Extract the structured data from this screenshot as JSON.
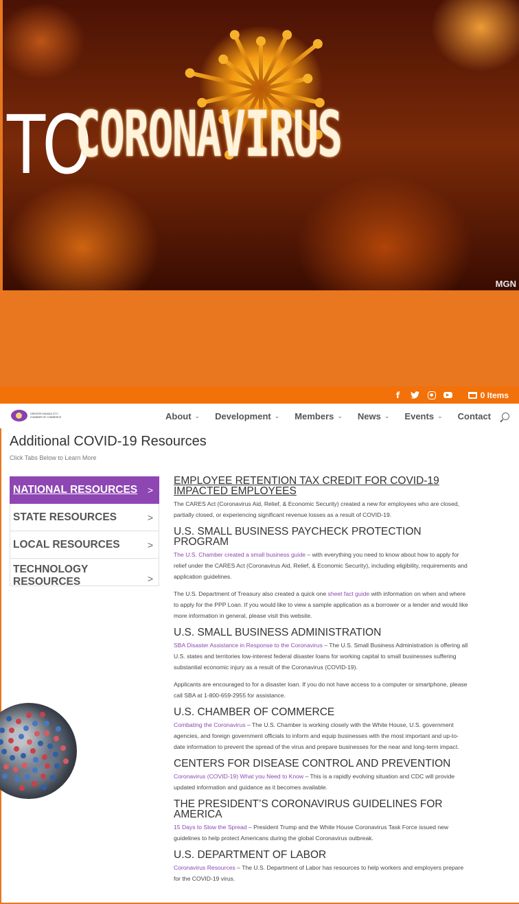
{
  "hero": {
    "big_text": "TO",
    "title": "CORONAVIRUS",
    "watermark": "MGN"
  },
  "top_bar": {
    "social": [
      "facebook-icon",
      "twitter-icon",
      "instagram-icon",
      "youtube-icon"
    ],
    "cart_label": "0 Items"
  },
  "header": {
    "logo_lines": [
      "GREATER KANSAS CITY",
      "CHAMBER OF COMMERCE"
    ],
    "nav": [
      {
        "label": "About",
        "has_dropdown": true
      },
      {
        "label": "Development",
        "has_dropdown": true
      },
      {
        "label": "Members",
        "has_dropdown": true
      },
      {
        "label": "News",
        "has_dropdown": true
      },
      {
        "label": "Events",
        "has_dropdown": true
      },
      {
        "label": "Contact",
        "has_dropdown": false
      }
    ]
  },
  "page": {
    "title": "Additional COVID-19 Resources",
    "subtitle": "Click Tabs Below to Learn More"
  },
  "tabs": [
    {
      "label": "NATIONAL RESOURCES",
      "arrow": ">",
      "active": true
    },
    {
      "label": "STATE RESOURCES",
      "arrow": ">",
      "active": false
    },
    {
      "label": "LOCAL RESOURCES",
      "arrow": ">",
      "active": false
    },
    {
      "label": "TECHNOLOGY RESOURCES",
      "arrow": ">",
      "active": false
    }
  ],
  "sections": [
    {
      "heading": "EMPLOYEE RETENTION TAX CREDIT FOR COVID-19 IMPACTED EMPLOYEES",
      "paragraphs": [
        {
          "link": "",
          "text": "The CARES Act (Coronavirus Aid, Relief, & Economic Security) created a new  for employees who are closed, partially closed, or experiencing significant revenue losses as a result of COVID-19."
        }
      ]
    },
    {
      "heading": "U.S. SMALL BUSINESS PAYCHECK PROTECTION PROGRAM",
      "paragraphs": [
        {
          "link": "The U.S. Chamber created a small business guide",
          "text": " – with everything you need to know about how to apply for relief under the CARES Act (Coronavirus Aid, Relief, & Economic Security), including eligibility, requirements and application guidelines."
        },
        {
          "pre": "The U.S. Department of Treasury also created a quick one ",
          "link": "sheet fact guide",
          "text": " with information on when and where to apply for the PPP Loan. If you would like to view a sample application as a borrower or a lender and would like more information in general, please visit this website."
        }
      ]
    },
    {
      "heading": "U.S. SMALL BUSINESS ADMINISTRATION",
      "paragraphs": [
        {
          "link": "SBA Disaster Assistance in Response to the Coronavirus",
          "text": " – The U.S. Small Business Administration is offering all U.S. states and territories low-interest federal disaster loans for working capital to small businesses suffering substantial economic injury as a result of the Coronavirus (COVID-19)."
        },
        {
          "link": "",
          "text": "Applicants are encouraged to  for a disaster loan. If you do not have access to a computer or smartphone, please call SBA at 1-800-659-2955 for assistance."
        }
      ]
    },
    {
      "heading": "U.S. CHAMBER OF COMMERCE",
      "paragraphs": [
        {
          "link": "Combating the Coronavirus",
          "text": " – The U.S. Chamber is working closely with the White House, U.S. government agencies, and foreign government officials to inform and equip businesses with the most important and up-to-date information to prevent the spread of the virus and prepare businesses for the near and long-term impact."
        }
      ]
    },
    {
      "heading": "CENTERS FOR DISEASE CONTROL AND PREVENTION",
      "paragraphs": [
        {
          "link": "Coronavirus (COVID-19) What you Need to Know",
          "text": " – This is a rapidly evolving situation and CDC will provide updated information and guidance as it becomes available."
        }
      ]
    },
    {
      "heading": "THE PRESIDENT’S CORONAVIRUS GUIDELINES FOR AMERICA",
      "paragraphs": [
        {
          "link": "15 Days to Slow the Spread",
          "text": " – President Trump and the White House Coronavirus Task Force issued new guidelines to help protect Americans during the global Coronavirus outbreak."
        }
      ]
    },
    {
      "heading": "U.S. DEPARTMENT OF LABOR",
      "paragraphs": [
        {
          "link": "Coronavirus Resources",
          "text": " – The U.S. Department of Labor has resources to help workers and employers prepare for the COVID-19 virus."
        }
      ]
    }
  ],
  "colors": {
    "accent_purple": "#8e46b3",
    "orange": "#e8771f",
    "topbar_orange": "#f27109"
  }
}
